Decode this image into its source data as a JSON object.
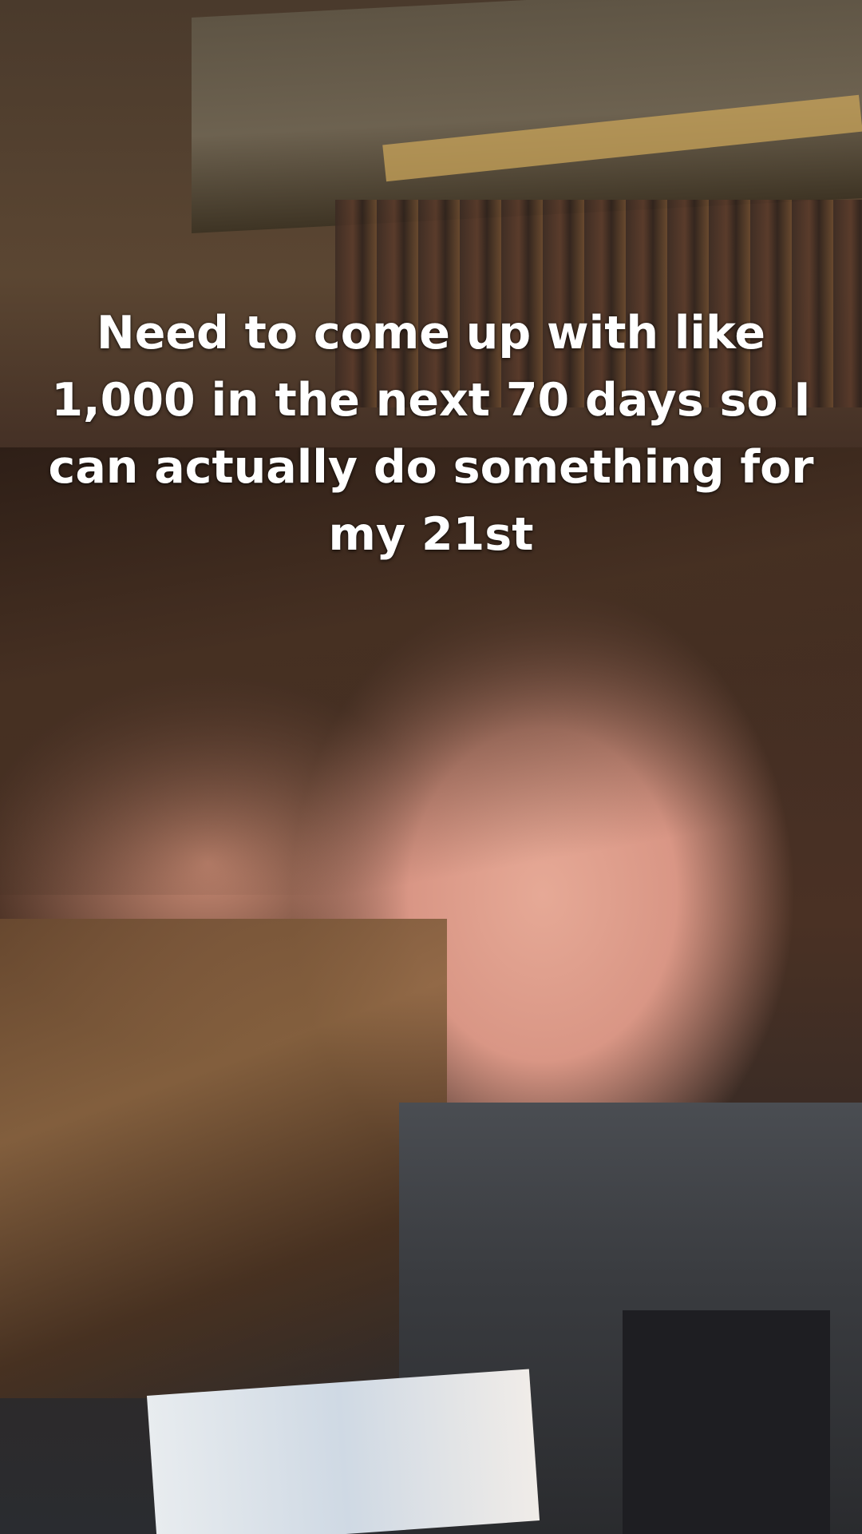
{
  "overlay": {
    "caption_lines": [
      "Need to come up with like",
      "1,000 in the next 70 days so I",
      "can actually do something for",
      "my 21st"
    ]
  }
}
